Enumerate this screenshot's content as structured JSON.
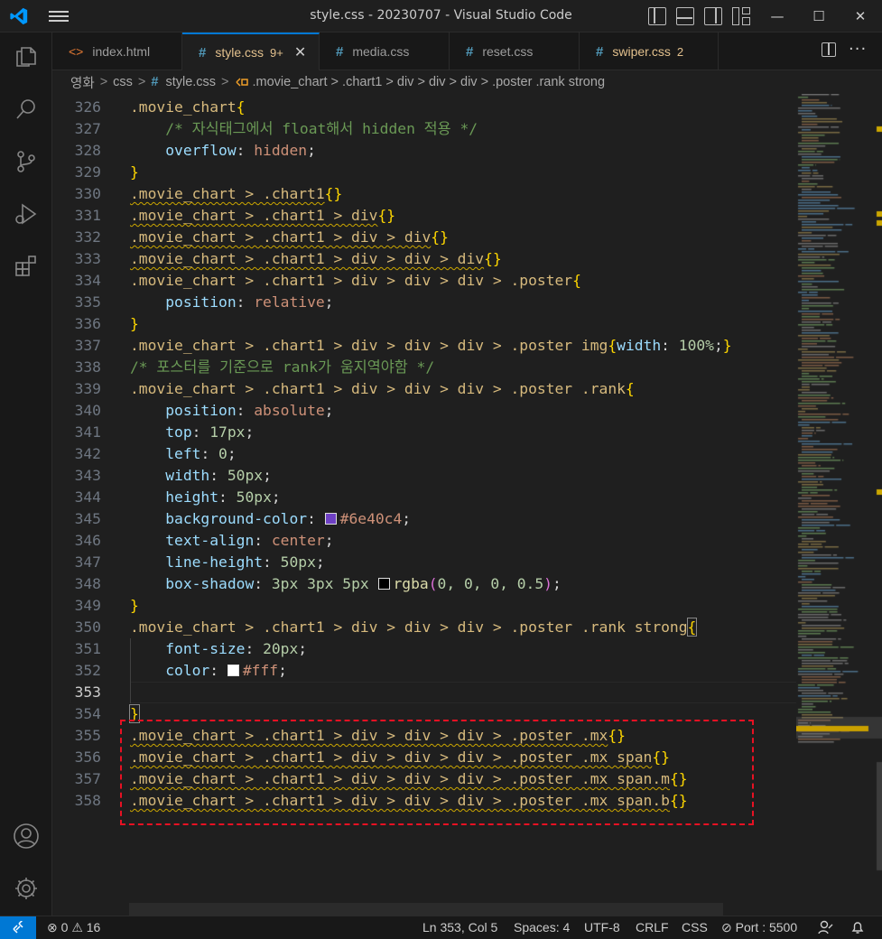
{
  "window": {
    "title": "style.css - 20230707 - Visual Studio Code",
    "controls": {
      "minimize": "—",
      "maximize": "☐",
      "close": "✕"
    }
  },
  "activity_bar": [
    "explorer-icon",
    "search-icon",
    "source-control-icon",
    "run-debug-icon",
    "extensions-icon",
    "account-icon",
    "settings-gear-icon"
  ],
  "tabs": [
    {
      "label": "index.html",
      "icon": "html-file-icon",
      "active": false
    },
    {
      "label": "style.css",
      "icon": "#",
      "badge": "9+",
      "close": "✕",
      "active": true
    },
    {
      "label": "media.css",
      "icon": "#",
      "active": false
    },
    {
      "label": "reset.css",
      "icon": "#",
      "active": false
    },
    {
      "label": "swiper.css",
      "icon": "#",
      "badge": "2",
      "active": false
    }
  ],
  "tab_actions": {
    "more": "···"
  },
  "breadcrumb": {
    "parts": [
      "영화",
      "css"
    ],
    "file": "style.css",
    "symbol": ".movie_chart > .chart1 > div > div > div > .poster .rank strong",
    "file_icon": "#",
    "symbol_icon": "css-selector-icon",
    "sep": ">"
  },
  "editor": {
    "current_line": 353,
    "lines": [
      {
        "n": "326",
        "t": [
          [
            ".movie_chart",
            "sel"
          ],
          [
            "{",
            "brace"
          ]
        ]
      },
      {
        "n": "327",
        "t": [
          [
            "    ",
            "op"
          ],
          [
            "/* 자식태그에서 float해서 hidden 적용 */",
            "com"
          ]
        ]
      },
      {
        "n": "328",
        "t": [
          [
            "    ",
            "op"
          ],
          [
            "overflow",
            "prop"
          ],
          [
            ": ",
            "op"
          ],
          [
            "hidden",
            "val"
          ],
          [
            ";",
            "op"
          ]
        ]
      },
      {
        "n": "329",
        "t": [
          [
            "}",
            "brace"
          ]
        ]
      },
      {
        "n": "330",
        "t": [
          [
            ".movie_chart > .chart1",
            "sel squig"
          ],
          [
            "{}",
            "brace"
          ]
        ]
      },
      {
        "n": "331",
        "t": [
          [
            ".movie_chart > .chart1 > div",
            "sel squig"
          ],
          [
            "{}",
            "brace"
          ]
        ]
      },
      {
        "n": "332",
        "t": [
          [
            ".movie_chart > .chart1 > div > div",
            "sel squig"
          ],
          [
            "{}",
            "brace"
          ]
        ]
      },
      {
        "n": "333",
        "t": [
          [
            ".movie_chart > .chart1 > div > div > div",
            "sel squig"
          ],
          [
            "{}",
            "brace"
          ]
        ]
      },
      {
        "n": "334",
        "t": [
          [
            ".movie_chart > .chart1 > div > div > div > .poster",
            "sel"
          ],
          [
            "{",
            "brace"
          ]
        ]
      },
      {
        "n": "335",
        "t": [
          [
            "    ",
            "op"
          ],
          [
            "position",
            "prop"
          ],
          [
            ": ",
            "op"
          ],
          [
            "relative",
            "val"
          ],
          [
            ";",
            "op"
          ]
        ]
      },
      {
        "n": "336",
        "t": [
          [
            "}",
            "brace"
          ]
        ]
      },
      {
        "n": "337",
        "t": [
          [
            ".movie_chart > .chart1 > div > div > div > .poster img",
            "sel"
          ],
          [
            "{",
            "brace"
          ],
          [
            "width",
            "prop"
          ],
          [
            ": ",
            "op"
          ],
          [
            "100%",
            "num"
          ],
          [
            ";",
            "op"
          ],
          [
            "}",
            "brace"
          ]
        ]
      },
      {
        "n": "338",
        "t": [
          [
            "/* 포스터를 기준으로 rank가 움지역야함 */",
            "com"
          ]
        ]
      },
      {
        "n": "339",
        "t": [
          [
            ".movie_chart > .chart1 > div > div > div > .poster .rank",
            "sel"
          ],
          [
            "{",
            "brace"
          ]
        ]
      },
      {
        "n": "340",
        "t": [
          [
            "    ",
            "op"
          ],
          [
            "position",
            "prop"
          ],
          [
            ": ",
            "op"
          ],
          [
            "absolute",
            "val"
          ],
          [
            ";",
            "op"
          ]
        ]
      },
      {
        "n": "341",
        "t": [
          [
            "    ",
            "op"
          ],
          [
            "top",
            "prop"
          ],
          [
            ": ",
            "op"
          ],
          [
            "17px",
            "num"
          ],
          [
            ";",
            "op"
          ]
        ]
      },
      {
        "n": "342",
        "t": [
          [
            "    ",
            "op"
          ],
          [
            "left",
            "prop"
          ],
          [
            ": ",
            "op"
          ],
          [
            "0",
            "num"
          ],
          [
            ";",
            "op"
          ]
        ]
      },
      {
        "n": "343",
        "t": [
          [
            "    ",
            "op"
          ],
          [
            "width",
            "prop"
          ],
          [
            ": ",
            "op"
          ],
          [
            "50px",
            "num"
          ],
          [
            ";",
            "op"
          ]
        ]
      },
      {
        "n": "344",
        "t": [
          [
            "    ",
            "op"
          ],
          [
            "height",
            "prop"
          ],
          [
            ": ",
            "op"
          ],
          [
            "50px",
            "num"
          ],
          [
            ";",
            "op"
          ]
        ]
      },
      {
        "n": "345",
        "t": [
          [
            "    ",
            "op"
          ],
          [
            "background-color",
            "prop"
          ],
          [
            ": ",
            "op"
          ],
          [
            "#6e40c4",
            "swatch"
          ],
          [
            "#6e40c4",
            "val"
          ],
          [
            ";",
            "op"
          ]
        ]
      },
      {
        "n": "346",
        "t": [
          [
            "    ",
            "op"
          ],
          [
            "text-align",
            "prop"
          ],
          [
            ": ",
            "op"
          ],
          [
            "center",
            "val"
          ],
          [
            ";",
            "op"
          ]
        ]
      },
      {
        "n": "347",
        "t": [
          [
            "    ",
            "op"
          ],
          [
            "line-height",
            "prop"
          ],
          [
            ": ",
            "op"
          ],
          [
            "50px",
            "num"
          ],
          [
            ";",
            "op"
          ]
        ]
      },
      {
        "n": "348",
        "t": [
          [
            "    ",
            "op"
          ],
          [
            "box-shadow",
            "prop"
          ],
          [
            ": ",
            "op"
          ],
          [
            "3px 3px 5px ",
            "num"
          ],
          [
            "#000000",
            "swatch"
          ],
          [
            "rgba",
            "fn"
          ],
          [
            "(",
            "paren"
          ],
          [
            "0, 0, 0, 0.5",
            "num"
          ],
          [
            ")",
            "paren"
          ],
          [
            ";",
            "op"
          ]
        ]
      },
      {
        "n": "349",
        "t": [
          [
            "}",
            "brace"
          ]
        ]
      },
      {
        "n": "350",
        "t": [
          [
            ".movie_chart > .chart1 > div > div > div > .poster .rank strong",
            "sel"
          ],
          [
            "{",
            "brace match"
          ]
        ]
      },
      {
        "n": "351",
        "t": [
          [
            "    ",
            "op"
          ],
          [
            "font-size",
            "prop"
          ],
          [
            ": ",
            "op"
          ],
          [
            "20px",
            "num"
          ],
          [
            ";",
            "op"
          ]
        ]
      },
      {
        "n": "352",
        "t": [
          [
            "    ",
            "op"
          ],
          [
            "color",
            "prop"
          ],
          [
            ": ",
            "op"
          ],
          [
            "#ffffff",
            "swatch"
          ],
          [
            "#fff",
            "val"
          ],
          [
            ";",
            "op"
          ]
        ]
      },
      {
        "n": "353",
        "t": []
      },
      {
        "n": "354",
        "t": [
          [
            "}",
            "brace match"
          ]
        ]
      },
      {
        "n": "355",
        "t": [
          [
            ".movie_chart > .chart1 > div > div > div > .poster .mx",
            "sel squig"
          ],
          [
            "{}",
            "brace"
          ]
        ]
      },
      {
        "n": "356",
        "t": [
          [
            ".movie_chart > .chart1 > div > div > div > .poster .mx span",
            "sel squig"
          ],
          [
            "{}",
            "brace"
          ]
        ]
      },
      {
        "n": "357",
        "t": [
          [
            ".movie_chart > .chart1 > div > div > div > .poster .mx span.m",
            "sel squig"
          ],
          [
            "{}",
            "brace"
          ]
        ]
      },
      {
        "n": "358",
        "t": [
          [
            ".movie_chart > .chart1 > div > div > div > .poster .mx span.b",
            "sel squig"
          ],
          [
            "{}",
            "brace"
          ]
        ]
      }
    ]
  },
  "statusbar": {
    "remote_icon": "remote-icon",
    "errors": "0",
    "warnings": "16",
    "position": "Ln 353, Col 5",
    "spaces": "Spaces: 4",
    "encoding": "UTF-8",
    "eol": "CRLF",
    "language": "CSS",
    "port": "Port : 5500",
    "feedback_icon": "feedback-icon",
    "bell_icon": "bell-icon"
  },
  "colors": {
    "accent": "#0078d4",
    "highlight_box": "#e81123",
    "warning_squiggle": "#cca700"
  }
}
